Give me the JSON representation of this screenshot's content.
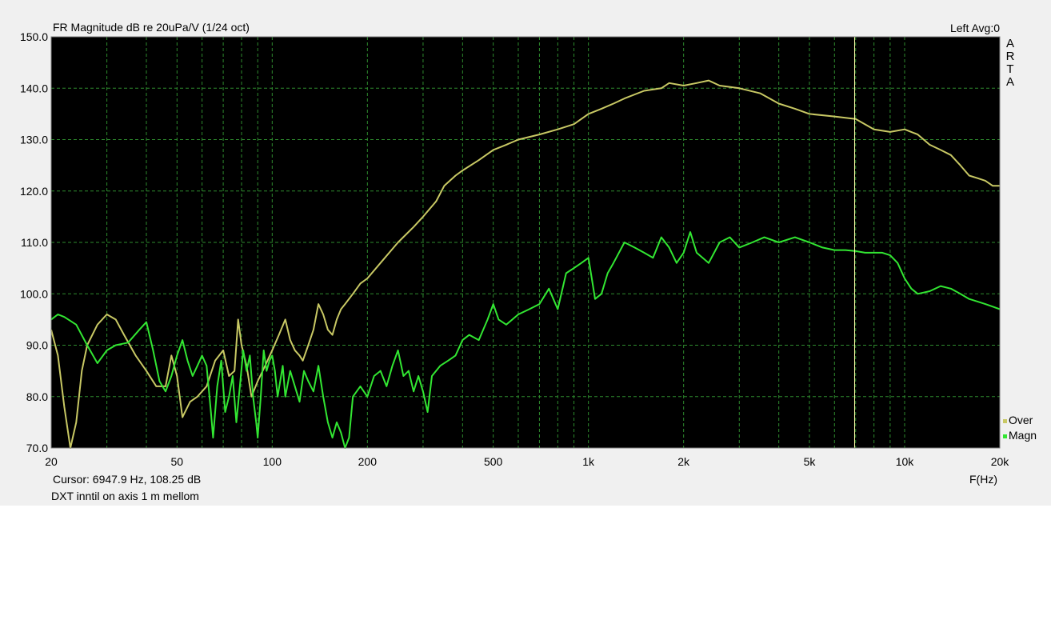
{
  "header": {
    "title": "FR Magnitude dB re 20uPa/V (1/24 oct)",
    "status": "Left  Avg:0"
  },
  "footer": {
    "cursor": "Cursor:  6947.9 Hz, 108.25 dB",
    "note": "DXT inntil on axis 1 m mellom",
    "x_unit": "F(Hz)"
  },
  "brand": {
    "letters": [
      "A",
      "R",
      "T",
      "A"
    ]
  },
  "colors": {
    "plot_bg": "#000000",
    "grid": "#2e8b2e",
    "over": "#c8c864",
    "magn": "#32e632",
    "cursor_line": "#ffffaa"
  },
  "chart_data": {
    "type": "line",
    "title": "FR Magnitude dB re 20uPa/V (1/24 oct)",
    "xlabel": "F(Hz)",
    "ylabel": "",
    "x_scale": "log",
    "xlim": [
      20,
      20000
    ],
    "ylim": [
      70,
      150
    ],
    "x_ticks": [
      20,
      50,
      100,
      200,
      500,
      1000,
      2000,
      5000,
      10000,
      20000
    ],
    "x_tick_labels": [
      "20",
      "50",
      "100",
      "200",
      "500",
      "1k",
      "2k",
      "5k",
      "10k",
      "20k"
    ],
    "y_ticks": [
      70,
      80,
      90,
      100,
      110,
      120,
      130,
      140,
      150
    ],
    "y_tick_labels": [
      "70.0",
      "80.0",
      "90.0",
      "100.0",
      "110.0",
      "120.0",
      "130.0",
      "140.0",
      "150.0"
    ],
    "grid": true,
    "cursor": {
      "x": 6947.9,
      "y": 108.25
    },
    "legend_position": "bottom-right",
    "series": [
      {
        "name": "Over",
        "color": "#c8c864",
        "points": [
          [
            20,
            93
          ],
          [
            21,
            88
          ],
          [
            22,
            78
          ],
          [
            23,
            70
          ],
          [
            24,
            75
          ],
          [
            25,
            85
          ],
          [
            26,
            90
          ],
          [
            28,
            94
          ],
          [
            30,
            96
          ],
          [
            32,
            95
          ],
          [
            34,
            92
          ],
          [
            37,
            88
          ],
          [
            40,
            85
          ],
          [
            43,
            82
          ],
          [
            46,
            82
          ],
          [
            48,
            88
          ],
          [
            50,
            84
          ],
          [
            52,
            76
          ],
          [
            55,
            79
          ],
          [
            58,
            80
          ],
          [
            62,
            82
          ],
          [
            66,
            87
          ],
          [
            70,
            89
          ],
          [
            73,
            84
          ],
          [
            76,
            85
          ],
          [
            78,
            95
          ],
          [
            80,
            90
          ],
          [
            83,
            86
          ],
          [
            86,
            80
          ],
          [
            90,
            83
          ],
          [
            95,
            86
          ],
          [
            100,
            89
          ],
          [
            105,
            92
          ],
          [
            110,
            95
          ],
          [
            114,
            91
          ],
          [
            118,
            89
          ],
          [
            122,
            88
          ],
          [
            125,
            87
          ],
          [
            130,
            90
          ],
          [
            135,
            93
          ],
          [
            140,
            98
          ],
          [
            145,
            96
          ],
          [
            150,
            93
          ],
          [
            155,
            92
          ],
          [
            160,
            95
          ],
          [
            165,
            97
          ],
          [
            170,
            98
          ],
          [
            180,
            100
          ],
          [
            190,
            102
          ],
          [
            200,
            103
          ],
          [
            220,
            106
          ],
          [
            250,
            110
          ],
          [
            280,
            113
          ],
          [
            300,
            115
          ],
          [
            330,
            118
          ],
          [
            350,
            121
          ],
          [
            380,
            123
          ],
          [
            400,
            124
          ],
          [
            450,
            126
          ],
          [
            500,
            128
          ],
          [
            550,
            129
          ],
          [
            600,
            130
          ],
          [
            700,
            131
          ],
          [
            800,
            132
          ],
          [
            900,
            133
          ],
          [
            1000,
            135
          ],
          [
            1100,
            136
          ],
          [
            1200,
            137
          ],
          [
            1300,
            138
          ],
          [
            1500,
            139.5
          ],
          [
            1700,
            140
          ],
          [
            1800,
            141
          ],
          [
            2000,
            140.5
          ],
          [
            2200,
            141
          ],
          [
            2400,
            141.5
          ],
          [
            2600,
            140.5
          ],
          [
            3000,
            140
          ],
          [
            3500,
            139
          ],
          [
            4000,
            137
          ],
          [
            4500,
            136
          ],
          [
            5000,
            135
          ],
          [
            6000,
            134.5
          ],
          [
            7000,
            134
          ],
          [
            8000,
            132
          ],
          [
            9000,
            131.5
          ],
          [
            10000,
            132
          ],
          [
            11000,
            131
          ],
          [
            12000,
            129
          ],
          [
            13000,
            128
          ],
          [
            14000,
            127
          ],
          [
            15000,
            125
          ],
          [
            16000,
            123
          ],
          [
            17000,
            122.5
          ],
          [
            18000,
            122
          ],
          [
            19000,
            121
          ],
          [
            20000,
            121
          ]
        ]
      },
      {
        "name": "Magn",
        "color": "#32e632",
        "points": [
          [
            20,
            95
          ],
          [
            21,
            96
          ],
          [
            22,
            95.5
          ],
          [
            24,
            94
          ],
          [
            26,
            90
          ],
          [
            28,
            86.5
          ],
          [
            30,
            89
          ],
          [
            32,
            90
          ],
          [
            35,
            90.5
          ],
          [
            38,
            93
          ],
          [
            40,
            94.5
          ],
          [
            42,
            89
          ],
          [
            44,
            83
          ],
          [
            46,
            81
          ],
          [
            48,
            84
          ],
          [
            50,
            88
          ],
          [
            52,
            91
          ],
          [
            54,
            87
          ],
          [
            56,
            84
          ],
          [
            58,
            86
          ],
          [
            60,
            88
          ],
          [
            62,
            86
          ],
          [
            64,
            77
          ],
          [
            65,
            72
          ],
          [
            67,
            82
          ],
          [
            69,
            87
          ],
          [
            71,
            77
          ],
          [
            73,
            80
          ],
          [
            75,
            84
          ],
          [
            77,
            75
          ],
          [
            79,
            82
          ],
          [
            81,
            89
          ],
          [
            83,
            85
          ],
          [
            85,
            88
          ],
          [
            87,
            80
          ],
          [
            89,
            75
          ],
          [
            90,
            72
          ],
          [
            92,
            80
          ],
          [
            94,
            89
          ],
          [
            96,
            85
          ],
          [
            98,
            87
          ],
          [
            100,
            88
          ],
          [
            102,
            85
          ],
          [
            104,
            80
          ],
          [
            106,
            83
          ],
          [
            108,
            86
          ],
          [
            110,
            80
          ],
          [
            114,
            85
          ],
          [
            118,
            82
          ],
          [
            122,
            79
          ],
          [
            126,
            85
          ],
          [
            130,
            83
          ],
          [
            135,
            81
          ],
          [
            140,
            86
          ],
          [
            145,
            80
          ],
          [
            150,
            75
          ],
          [
            155,
            72
          ],
          [
            160,
            75
          ],
          [
            165,
            73
          ],
          [
            170,
            70
          ],
          [
            175,
            72
          ],
          [
            180,
            80
          ],
          [
            190,
            82
          ],
          [
            200,
            80
          ],
          [
            210,
            84
          ],
          [
            220,
            85
          ],
          [
            230,
            82
          ],
          [
            240,
            86
          ],
          [
            250,
            89
          ],
          [
            260,
            84
          ],
          [
            270,
            85
          ],
          [
            280,
            81
          ],
          [
            290,
            84
          ],
          [
            300,
            81
          ],
          [
            310,
            77
          ],
          [
            320,
            84
          ],
          [
            340,
            86
          ],
          [
            360,
            87
          ],
          [
            380,
            88
          ],
          [
            400,
            91
          ],
          [
            420,
            92
          ],
          [
            450,
            91
          ],
          [
            480,
            95
          ],
          [
            500,
            98
          ],
          [
            520,
            95
          ],
          [
            550,
            94
          ],
          [
            600,
            96
          ],
          [
            650,
            97
          ],
          [
            700,
            98
          ],
          [
            750,
            101
          ],
          [
            800,
            97
          ],
          [
            850,
            104
          ],
          [
            900,
            105
          ],
          [
            950,
            106
          ],
          [
            1000,
            107
          ],
          [
            1050,
            99
          ],
          [
            1100,
            100
          ],
          [
            1150,
            104
          ],
          [
            1200,
            106
          ],
          [
            1300,
            110
          ],
          [
            1400,
            109
          ],
          [
            1500,
            108
          ],
          [
            1600,
            107
          ],
          [
            1700,
            111
          ],
          [
            1800,
            109
          ],
          [
            1900,
            106
          ],
          [
            2000,
            108
          ],
          [
            2100,
            112
          ],
          [
            2200,
            108
          ],
          [
            2400,
            106
          ],
          [
            2600,
            110
          ],
          [
            2800,
            111
          ],
          [
            3000,
            109
          ],
          [
            3300,
            110
          ],
          [
            3600,
            111
          ],
          [
            4000,
            110
          ],
          [
            4500,
            111
          ],
          [
            5000,
            110
          ],
          [
            5500,
            109
          ],
          [
            6000,
            108.5
          ],
          [
            6500,
            108.5
          ],
          [
            7000,
            108.3
          ],
          [
            7500,
            108
          ],
          [
            8000,
            108
          ],
          [
            8500,
            108
          ],
          [
            9000,
            107.5
          ],
          [
            9500,
            106
          ],
          [
            10000,
            103
          ],
          [
            10500,
            101
          ],
          [
            11000,
            100
          ],
          [
            12000,
            100.5
          ],
          [
            13000,
            101.5
          ],
          [
            14000,
            101
          ],
          [
            15000,
            100
          ],
          [
            16000,
            99
          ],
          [
            17000,
            98.5
          ],
          [
            18000,
            98
          ],
          [
            19000,
            97.5
          ],
          [
            20000,
            97
          ]
        ]
      }
    ]
  }
}
